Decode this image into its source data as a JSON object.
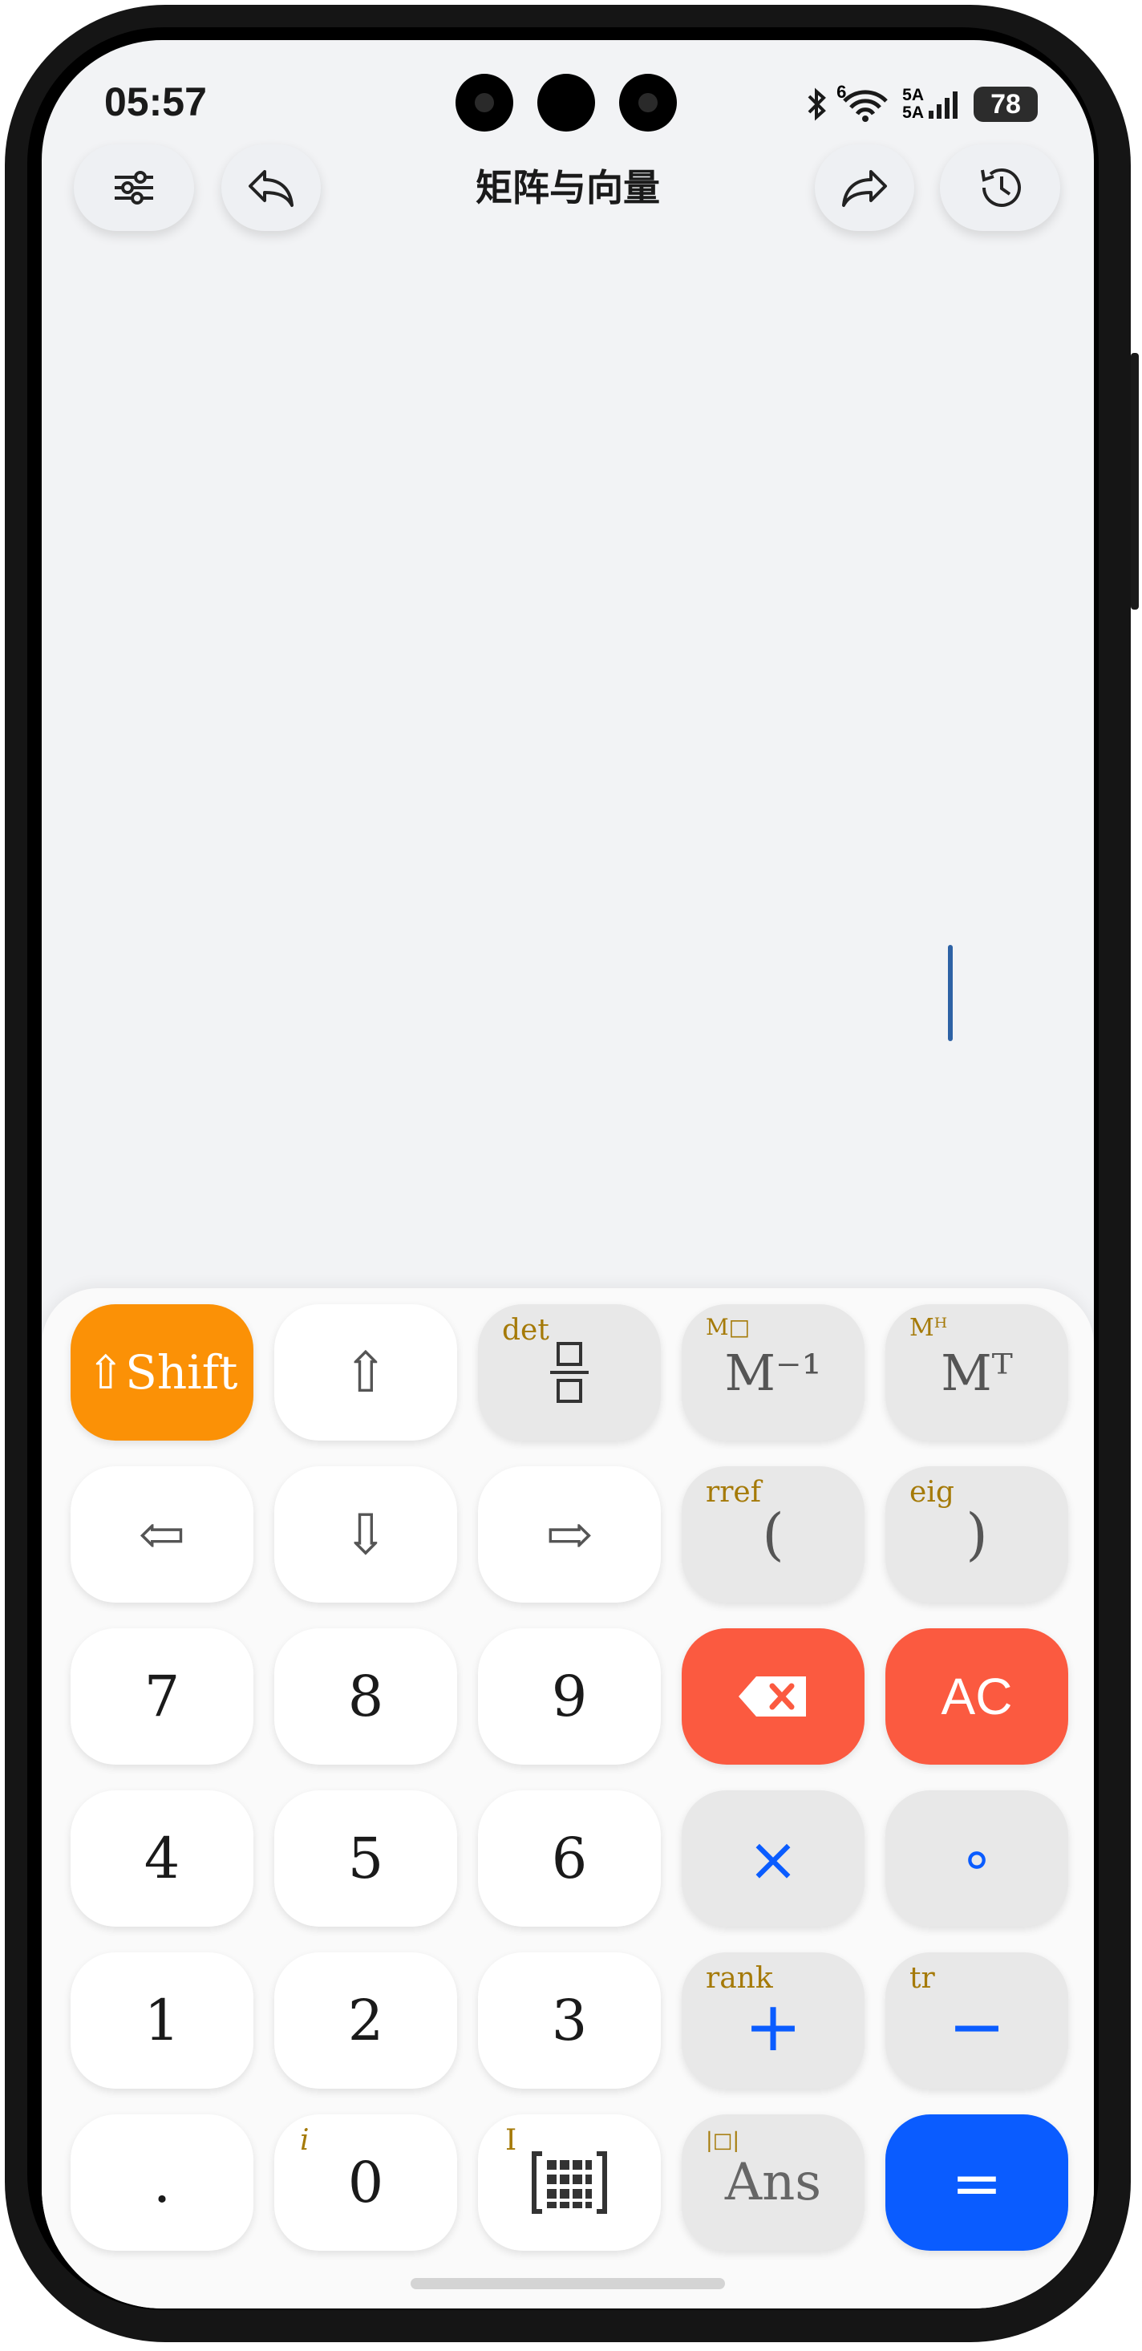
{
  "status": {
    "time": "05:57",
    "network_1": "5A",
    "network_2": "5A",
    "signal_label": "6",
    "battery": "78"
  },
  "header": {
    "title": "矩阵与向量",
    "settings_icon": "sliders-icon",
    "undo_icon": "undo-icon",
    "redo_icon": "redo-icon",
    "history_icon": "history-icon"
  },
  "keypad": {
    "shift": "⇧Shift",
    "up": "⇧",
    "left": "⇦",
    "down": "⇩",
    "right": "⇨",
    "fraction_sub": "det",
    "inverse": "M⁻¹",
    "inverse_sub": "M□",
    "transpose": "Mᵀ",
    "transpose_sub": "Mᴴ",
    "paren_open": "(",
    "paren_open_sub": "rref",
    "paren_close": ")",
    "paren_close_sub": "eig",
    "seven": "7",
    "eight": "8",
    "nine": "9",
    "ac": "AC",
    "four": "4",
    "five": "5",
    "six": "6",
    "multiply": "×",
    "compose": "∘",
    "one": "1",
    "two": "2",
    "three": "3",
    "plus": "+",
    "plus_sub": "rank",
    "minus": "−",
    "minus_sub": "tr",
    "dot": ".",
    "zero": "0",
    "zero_sub": "i",
    "matrix_sub": "I",
    "ans": "Ans",
    "ans_sub": "|□|",
    "equals": "="
  },
  "colors": {
    "shift": "#fb9106",
    "delete": "#fb5a40",
    "equals": "#0a5cff",
    "operator_blue": "#0a5cff",
    "secondary_gold": "#a57a08"
  }
}
